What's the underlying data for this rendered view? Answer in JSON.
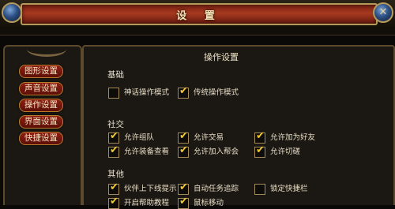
{
  "window": {
    "title": "设 置",
    "close_glyph": "✕"
  },
  "nav": {
    "items": [
      {
        "label": "图形设置"
      },
      {
        "label": "声音设置"
      },
      {
        "label": "操作设置"
      },
      {
        "label": "界面设置"
      },
      {
        "label": "快捷设置"
      }
    ]
  },
  "panel": {
    "title": "操作设置",
    "sections": [
      {
        "label": "基础",
        "options": [
          {
            "label": "神话操作模式",
            "checked": false
          },
          {
            "label": "传统操作模式",
            "checked": true
          }
        ]
      },
      {
        "label": "社交",
        "options": [
          {
            "label": "允许组队",
            "checked": true
          },
          {
            "label": "允许交易",
            "checked": true
          },
          {
            "label": "允许加为好友",
            "checked": true
          },
          {
            "label": "允许装备查看",
            "checked": true
          },
          {
            "label": "允许加入帮会",
            "checked": true
          },
          {
            "label": "允许切磋",
            "checked": true
          }
        ]
      },
      {
        "label": "其他",
        "options": [
          {
            "label": "伙伴上下线提示",
            "checked": true
          },
          {
            "label": "自动任务追踪",
            "checked": true
          },
          {
            "label": "锁定快捷栏",
            "checked": false
          },
          {
            "label": "开启帮助教程",
            "checked": true
          },
          {
            "label": "鼠标移动",
            "checked": true
          }
        ]
      }
    ],
    "check_glyph": "✔",
    "colors": {
      "accent": "#a63a20",
      "check": "#f0c830",
      "frame": "#5b4a2c"
    }
  }
}
